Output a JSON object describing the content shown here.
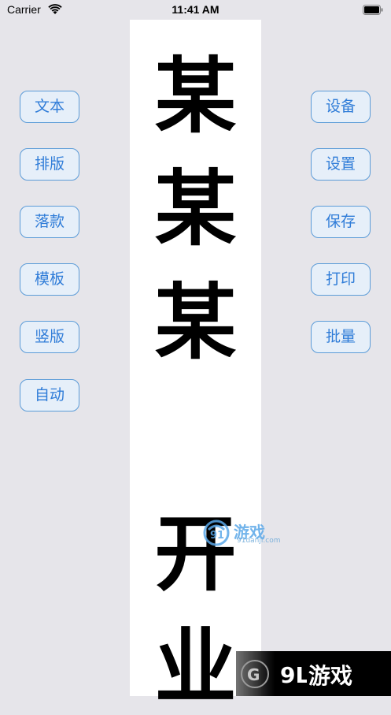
{
  "status_bar": {
    "carrier": "Carrier",
    "time": "11:41 AM"
  },
  "canvas": {
    "characters": [
      "某",
      "某",
      "某",
      "开",
      "业"
    ]
  },
  "left_buttons": [
    "文本",
    "排版",
    "落款",
    "模板",
    "竖版",
    "自动"
  ],
  "right_buttons": [
    "设备",
    "设置",
    "保存",
    "打印",
    "批量"
  ],
  "watermark": {
    "logo_text": "游戏",
    "domain": "91danji.com",
    "bar_text": "游戏",
    "bar_mark": "9L"
  }
}
